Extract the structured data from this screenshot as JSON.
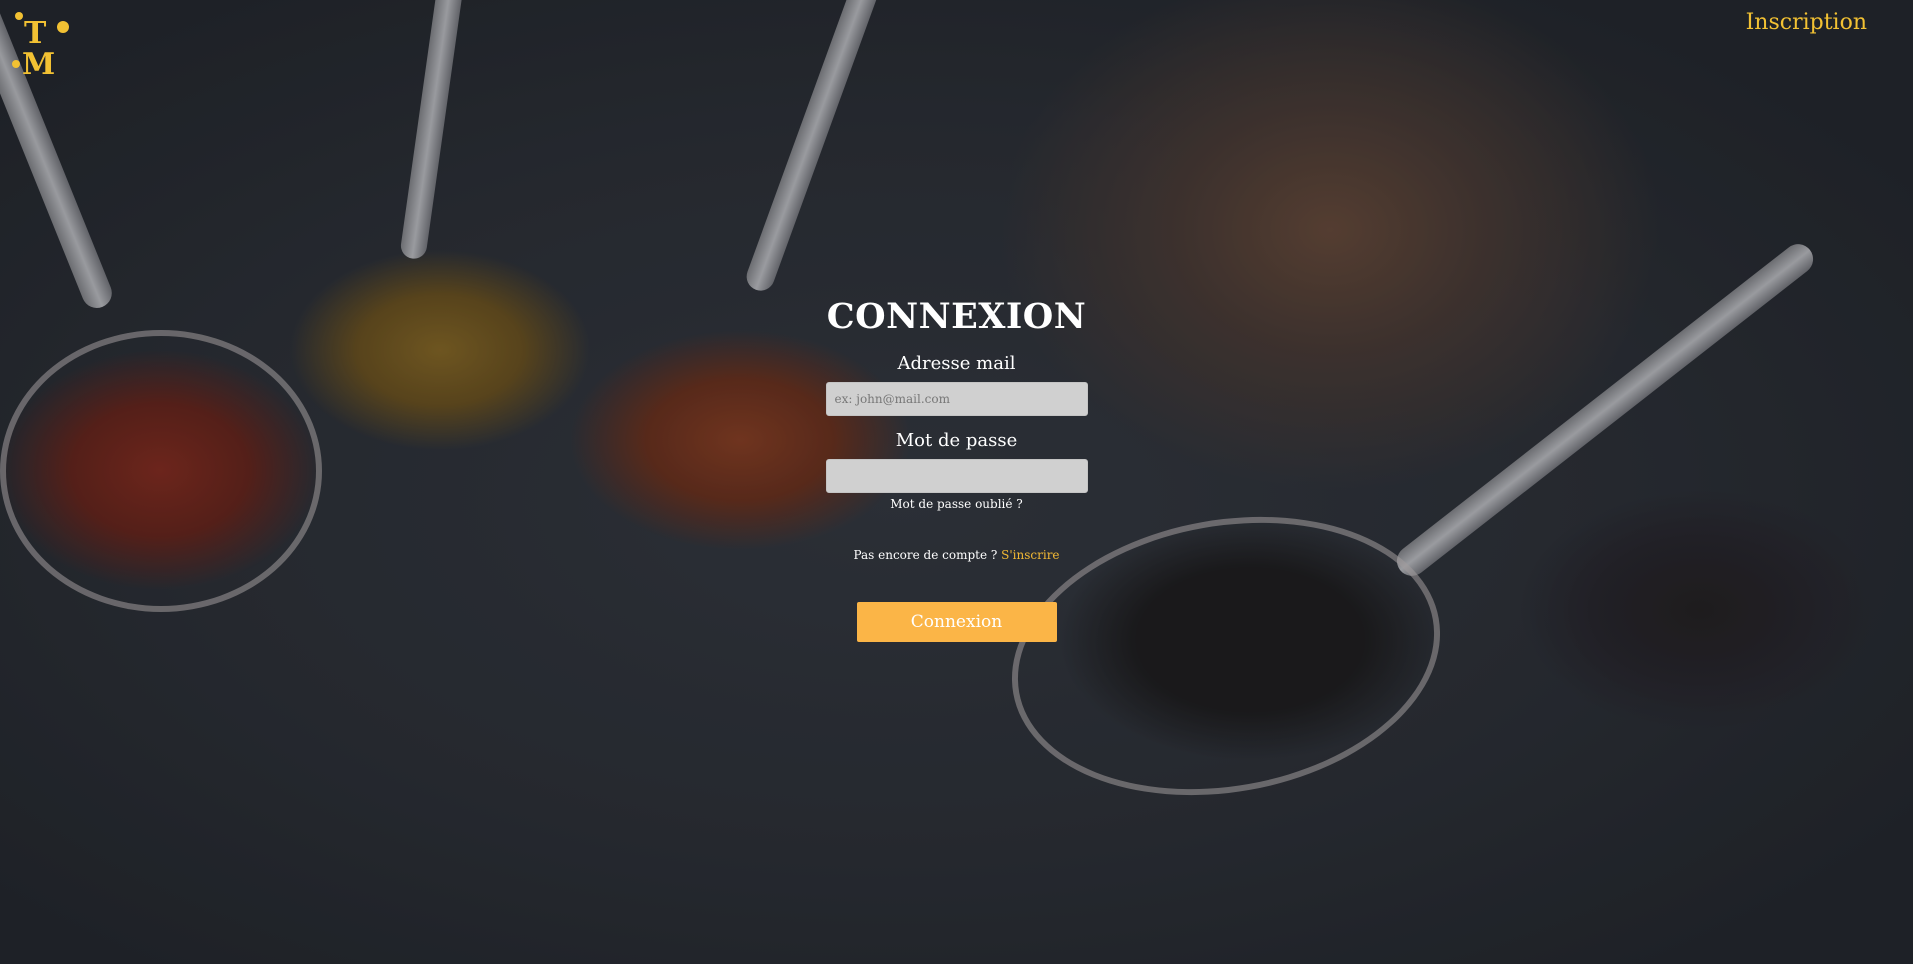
{
  "header": {
    "logo_letters": "TM",
    "signup_link": "Inscription"
  },
  "form": {
    "title": "CONNEXION",
    "email_label": "Adresse mail",
    "email_placeholder": "ex: john@mail.com",
    "email_value": "",
    "password_label": "Mot de passe",
    "password_value": "",
    "forgot_password": "Mot de passe oublié ?",
    "no_account_text": "Pas encore de compte ?",
    "register_link": "S'inscrire",
    "submit_label": "Connexion"
  },
  "colors": {
    "accent": "#f2c133",
    "button": "#fbb547",
    "input_bg": "#d0d0d0"
  }
}
